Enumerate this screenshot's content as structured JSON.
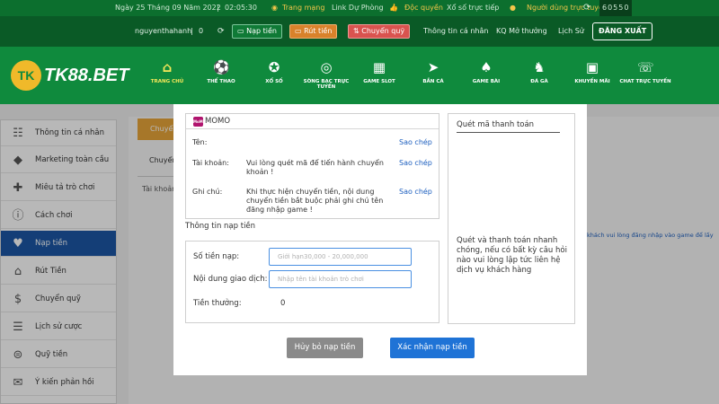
{
  "topbar": {
    "date": "Ngày 25 Tháng 09 Năm 2022",
    "time": "02:05:30",
    "trang_mang": "Trang mạng",
    "link_du_phong": "Link Dự Phòng",
    "doc_quyen": "Độc quyền",
    "xo_so": "Xổ số trực tiếp",
    "online_label": "Người dùng trực tuyến",
    "online_count": "60550"
  },
  "userbar": {
    "username": "nguyenthahanh",
    "balance": "0",
    "nap_tien": "Nạp tiền",
    "rut_tien": "Rút tiền",
    "chuyen_quy": "Chuyển quỹ",
    "thong_tin": "Thông tin cá nhân",
    "kq_mo_thuong": "KQ Mở thưởng",
    "lich_su": "Lịch Sử",
    "dang_xuat": "ĐĂNG XUẤT"
  },
  "logo": {
    "mark": "TK",
    "text": "TK88.BET"
  },
  "nav": [
    {
      "label": "TRANG CHỦ",
      "icon": "home-icon",
      "active": true
    },
    {
      "label": "THỂ THAO",
      "icon": "soccer-icon"
    },
    {
      "label": "XỔ SỐ",
      "icon": "lottery-icon"
    },
    {
      "label": "SÒNG BẠC TRỰC TUYẾN",
      "icon": "casino-icon"
    },
    {
      "label": "GAME SLOT",
      "icon": "slot-icon"
    },
    {
      "label": "BẮN CÁ",
      "icon": "fish-icon"
    },
    {
      "label": "GAME BÀI",
      "icon": "cards-icon"
    },
    {
      "label": "ĐÁ GÀ",
      "icon": "rooster-icon"
    },
    {
      "label": "KHUYẾN MÃI",
      "icon": "gift-icon"
    },
    {
      "label": "CHAT TRỰC TUYẾN",
      "icon": "chat-icon"
    }
  ],
  "sidebar": [
    {
      "label": "Thông tin cá nhân",
      "icon": "user-card-icon"
    },
    {
      "label": "Marketing toàn cầu",
      "icon": "diamond-icon"
    },
    {
      "label": "Miêu tả trò chơi",
      "icon": "gamepad-icon"
    },
    {
      "label": "Cách chơi",
      "icon": "info-icon"
    },
    {
      "label": "Nạp tiền",
      "icon": "piggy-bank-icon",
      "active": true
    },
    {
      "label": "Rút Tiền",
      "icon": "bank-icon"
    },
    {
      "label": "Chuyển quỹ",
      "icon": "dollar-icon"
    },
    {
      "label": "Lịch sử cược",
      "icon": "receipt-icon"
    },
    {
      "label": "Quỹ tiền",
      "icon": "coins-icon"
    },
    {
      "label": "Ý kiến phản hồi",
      "icon": "feedback-icon"
    }
  ],
  "background": {
    "tab": "Chuyển",
    "sub": "Chuyển",
    "account": "Tài khoản",
    "hint": "khách vui lòng đăng nhập vào game để lấy"
  },
  "modal": {
    "momo": {
      "logo_text": "MoMo",
      "name": "MOMO",
      "ten_label": "Tên:",
      "tai_khoan_label": "Tài khoản:",
      "tai_khoan_value": "Vui lòng quét mã để tiến hành chuyển khoản !",
      "ghi_chu_label": "Ghi chú:",
      "ghi_chu_value": "Khi thực hiện chuyển tiền, nội dung chuyển tiền bắt buộc phải ghi chú tên đăng nhập game !",
      "copy": "Sao chép"
    },
    "deposit": {
      "title": "Thông tin nạp tiền",
      "amount_label": "Số tiền nạp:",
      "amount_placeholder": "Giới hạn30,000 - 20,000,000",
      "content_label": "Nội dung giao dịch:",
      "content_placeholder": "Nhập tên tài khoản trò chơi",
      "bonus_label": "Tiền thưởng:",
      "bonus_value": "0"
    },
    "qr": {
      "title": "Quét mã thanh toán",
      "desc": "Quét và thanh toán nhanh chóng, nếu có bất kỳ câu hỏi nào vui lòng lập tức liên hệ dịch vụ khách hàng"
    },
    "buttons": {
      "cancel": "Hủy bỏ nạp tiền",
      "confirm": "Xác nhận nạp tiền"
    }
  },
  "colors": {
    "nav_green": "#0f8a3d",
    "topbar_green": "#0c6f2e",
    "active_blue": "#1c57a5",
    "confirm_blue": "#1f73d6",
    "link_blue": "#1d5fbf",
    "accent_yellow": "#f6e85a"
  }
}
